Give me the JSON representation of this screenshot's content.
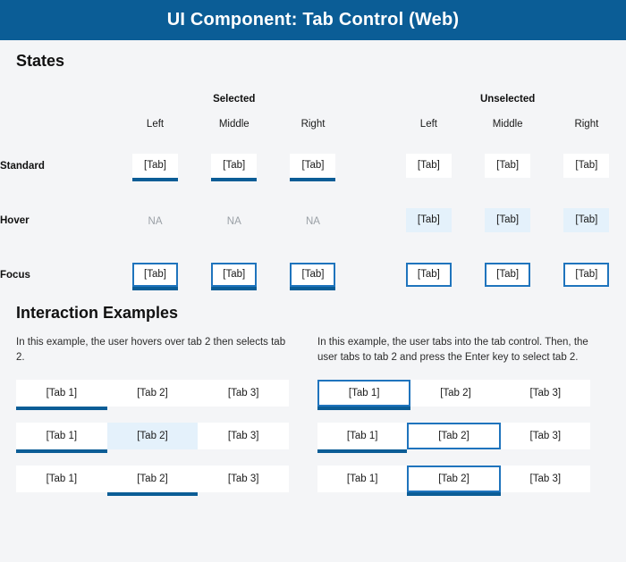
{
  "titlebar": {
    "title": "UI Component: Tab Control (Web)"
  },
  "colors": {
    "title_bar_bg": "#0b5d96",
    "accent_blue": "#0b5d96",
    "focus_outline": "#1f74bd",
    "hover_bg": "#e4f1fb",
    "page_bg": "#f4f5f7",
    "tab_bg": "#ffffff",
    "na_text": "#9aa0a6"
  },
  "states": {
    "heading": "States",
    "groups": [
      {
        "label": "Selected",
        "columns": [
          "Left",
          "Middle",
          "Right"
        ]
      },
      {
        "label": "Unselected",
        "columns": [
          "Left",
          "Middle",
          "Right"
        ]
      }
    ],
    "tab_label": "[Tab]",
    "na_label": "NA",
    "rows": [
      {
        "label": "Standard",
        "cells": [
          {
            "type": "tab",
            "selected": true,
            "hover": false,
            "focus": false
          },
          {
            "type": "tab",
            "selected": true,
            "hover": false,
            "focus": false
          },
          {
            "type": "tab",
            "selected": true,
            "hover": false,
            "focus": false
          },
          {
            "type": "tab",
            "selected": false,
            "hover": false,
            "focus": false
          },
          {
            "type": "tab",
            "selected": false,
            "hover": false,
            "focus": false
          },
          {
            "type": "tab",
            "selected": false,
            "hover": false,
            "focus": false
          }
        ]
      },
      {
        "label": "Hover",
        "cells": [
          {
            "type": "na"
          },
          {
            "type": "na"
          },
          {
            "type": "na"
          },
          {
            "type": "tab",
            "selected": false,
            "hover": true,
            "focus": false
          },
          {
            "type": "tab",
            "selected": false,
            "hover": true,
            "focus": false
          },
          {
            "type": "tab",
            "selected": false,
            "hover": true,
            "focus": false
          }
        ]
      },
      {
        "label": "Focus",
        "cells": [
          {
            "type": "tab",
            "selected": true,
            "hover": false,
            "focus": true
          },
          {
            "type": "tab",
            "selected": true,
            "hover": false,
            "focus": true
          },
          {
            "type": "tab",
            "selected": true,
            "hover": false,
            "focus": true
          },
          {
            "type": "tab",
            "selected": false,
            "hover": false,
            "focus": true
          },
          {
            "type": "tab",
            "selected": false,
            "hover": false,
            "focus": true
          },
          {
            "type": "tab",
            "selected": false,
            "hover": false,
            "focus": true
          }
        ]
      }
    ]
  },
  "interaction": {
    "heading": "Interaction Examples",
    "examples": [
      {
        "caption": "In this example, the user hovers over tab 2 then selects tab 2.",
        "strips": [
          {
            "tabs": [
              {
                "label": "[Tab 1]",
                "selected": true,
                "hover": false,
                "focus": false
              },
              {
                "label": "[Tab 2]",
                "selected": false,
                "hover": false,
                "focus": false
              },
              {
                "label": "[Tab 3]",
                "selected": false,
                "hover": false,
                "focus": false
              }
            ]
          },
          {
            "tabs": [
              {
                "label": "[Tab 1]",
                "selected": true,
                "hover": false,
                "focus": false
              },
              {
                "label": "[Tab 2]",
                "selected": false,
                "hover": true,
                "focus": false
              },
              {
                "label": "[Tab 3]",
                "selected": false,
                "hover": false,
                "focus": false
              }
            ]
          },
          {
            "tabs": [
              {
                "label": "[Tab 1]",
                "selected": false,
                "hover": false,
                "focus": false
              },
              {
                "label": "[Tab 2]",
                "selected": true,
                "hover": false,
                "focus": false
              },
              {
                "label": "[Tab 3]",
                "selected": false,
                "hover": false,
                "focus": false
              }
            ]
          }
        ]
      },
      {
        "caption": "In this example, the user tabs into the tab control. Then, the user tabs to tab 2 and press the Enter key to select tab 2.",
        "strips": [
          {
            "tabs": [
              {
                "label": "[Tab 1]",
                "selected": true,
                "hover": false,
                "focus": true
              },
              {
                "label": "[Tab 2]",
                "selected": false,
                "hover": false,
                "focus": false
              },
              {
                "label": "[Tab 3]",
                "selected": false,
                "hover": false,
                "focus": false
              }
            ]
          },
          {
            "tabs": [
              {
                "label": "[Tab 1]",
                "selected": true,
                "hover": false,
                "focus": false
              },
              {
                "label": "[Tab 2]",
                "selected": false,
                "hover": false,
                "focus": true
              },
              {
                "label": "[Tab 3]",
                "selected": false,
                "hover": false,
                "focus": false
              }
            ]
          },
          {
            "tabs": [
              {
                "label": "[Tab 1]",
                "selected": false,
                "hover": false,
                "focus": false
              },
              {
                "label": "[Tab 2]",
                "selected": true,
                "hover": false,
                "focus": true
              },
              {
                "label": "[Tab 3]",
                "selected": false,
                "hover": false,
                "focus": false
              }
            ]
          }
        ]
      }
    ]
  }
}
